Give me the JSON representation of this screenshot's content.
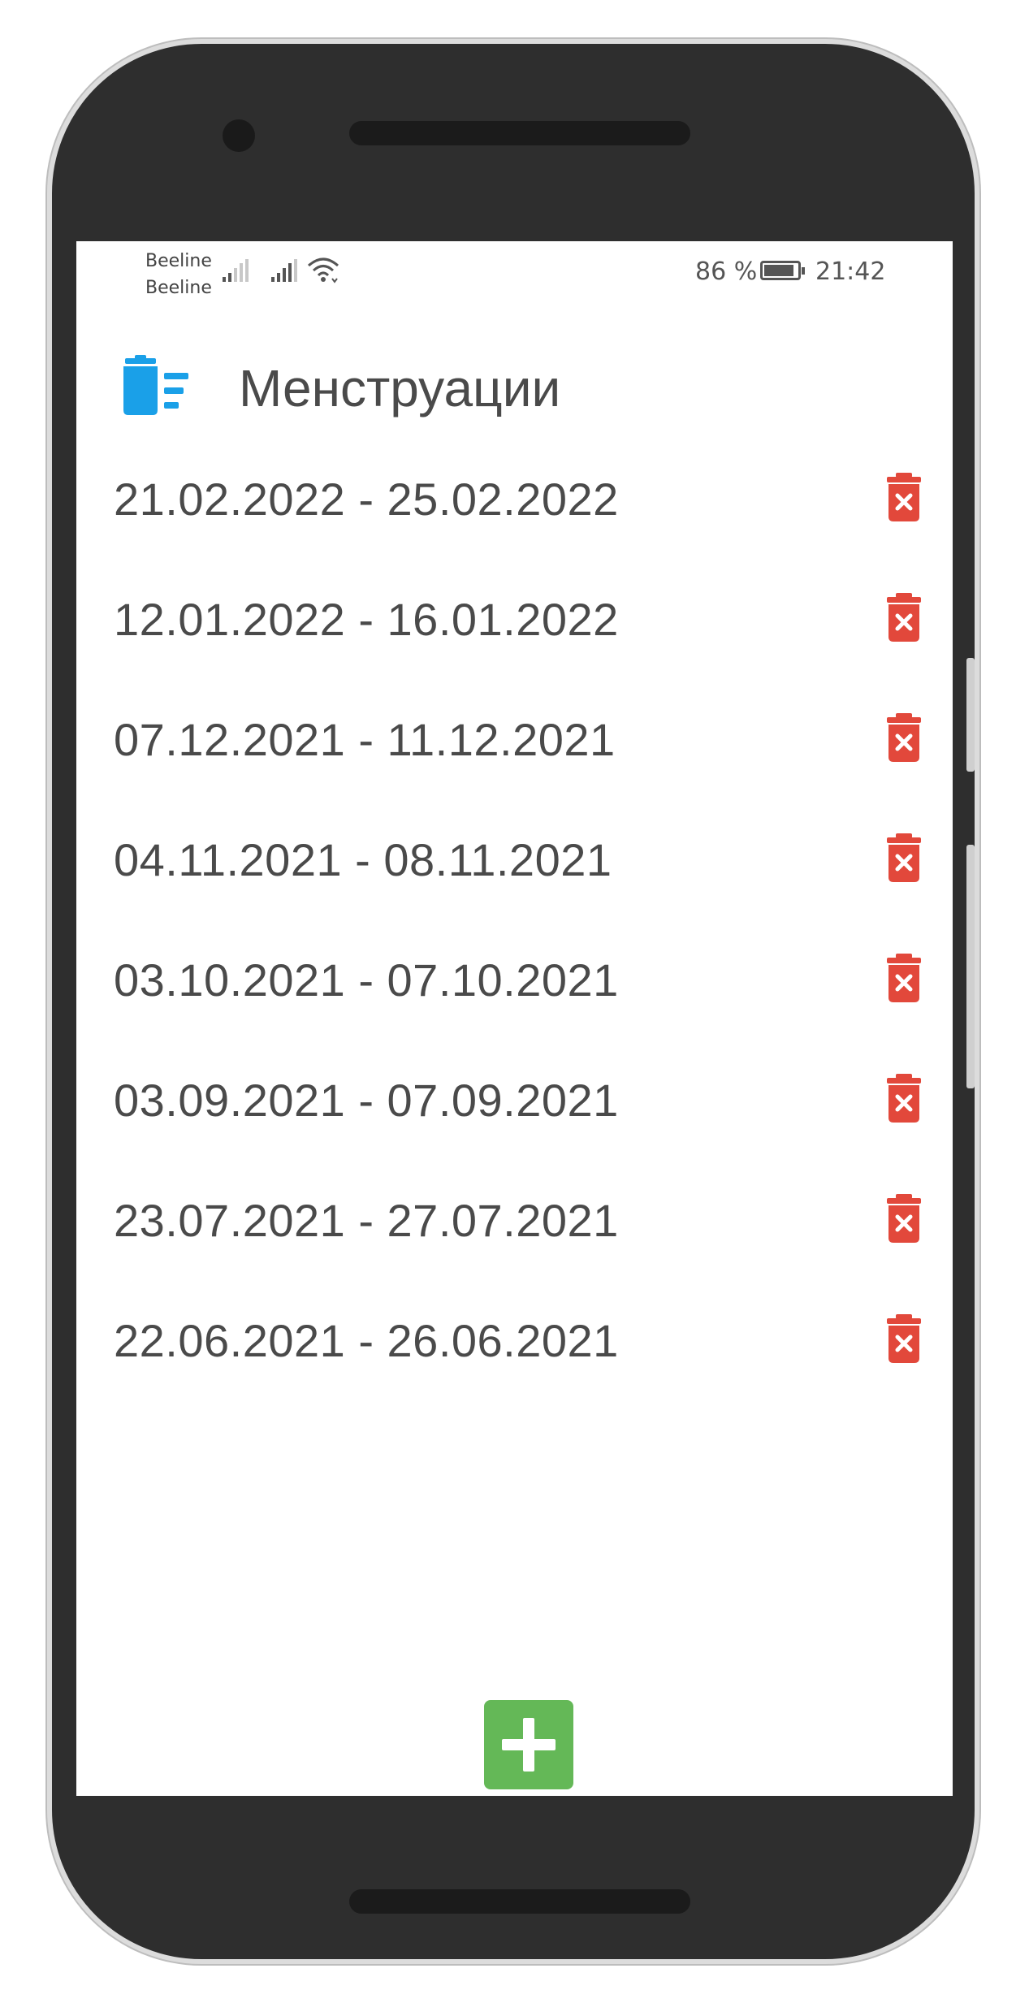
{
  "status_bar": {
    "carrier_1": "Beeline",
    "carrier_2": "Beeline",
    "battery_percent": "86 %",
    "battery_level": 0.86,
    "time": "21:42"
  },
  "header": {
    "title": "Менструации",
    "icon": "list-trash-icon"
  },
  "periods": [
    {
      "range": "21.02.2022 - 25.02.2022"
    },
    {
      "range": "12.01.2022 - 16.01.2022"
    },
    {
      "range": "07.12.2021 - 11.12.2021"
    },
    {
      "range": "04.11.2021 - 08.11.2021"
    },
    {
      "range": "03.10.2021 - 07.10.2021"
    },
    {
      "range": "03.09.2021 - 07.09.2021"
    },
    {
      "range": "23.07.2021 - 27.07.2021"
    },
    {
      "range": "22.06.2021 - 26.06.2021"
    }
  ],
  "icons": {
    "delete": "trash-x-icon",
    "add": "plus-icon"
  },
  "colors": {
    "accent_blue": "#1aa0e8",
    "delete_red": "#e2483b",
    "add_green": "#64b857",
    "text": "#4a4a4a"
  }
}
